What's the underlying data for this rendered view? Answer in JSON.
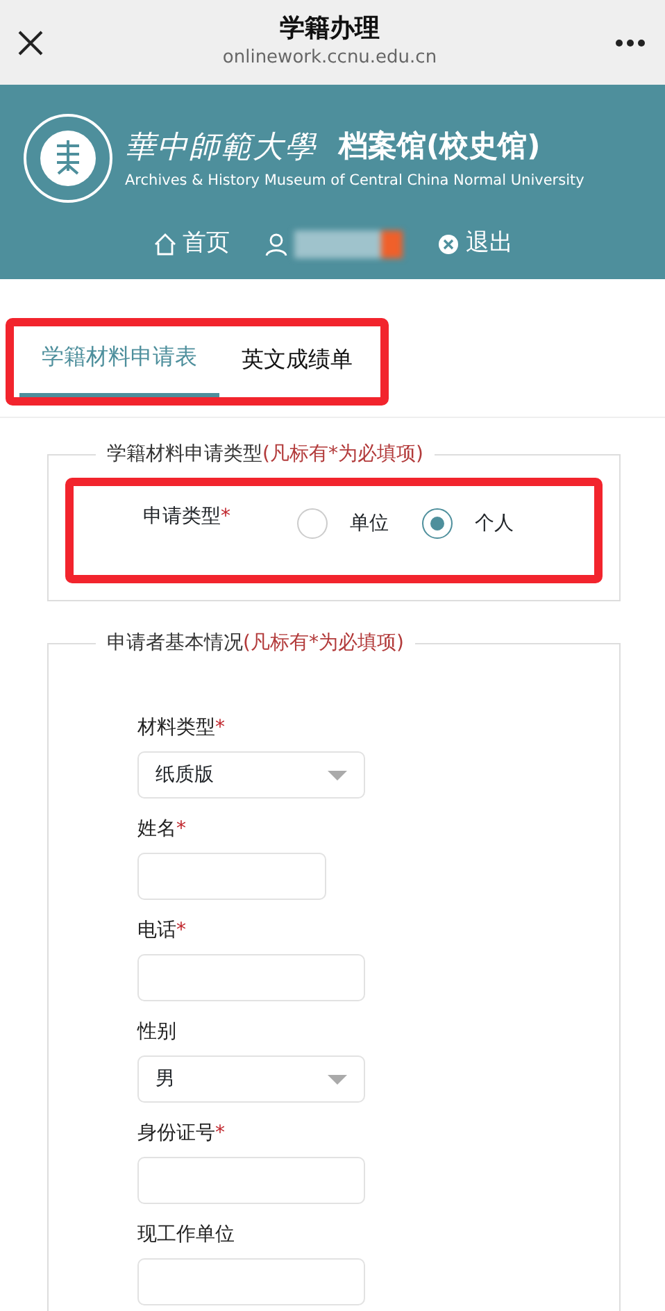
{
  "browser_bar": {
    "title": "学籍办理",
    "url": "onlinework.ccnu.edu.cn"
  },
  "header": {
    "university_name": "華中師範大學",
    "museum_name": "档案馆(校史馆)",
    "subtitle": "Archives & History Museum of Central China Normal University",
    "nav": [
      {
        "kind": "home",
        "label": "首页"
      },
      {
        "kind": "user"
      },
      {
        "kind": "logout",
        "label": "退出"
      }
    ]
  },
  "tabs": {
    "highlighted": true,
    "items": [
      {
        "label": "学籍材料申请表",
        "selected": true
      },
      {
        "label": "英文成绩单",
        "selected": false
      }
    ]
  },
  "sections": [
    {
      "legend": "学籍材料申请类型",
      "legend_note": "(凡标有*为必填项)",
      "kind": "radio",
      "highlighted": true,
      "label": "申请类型",
      "required_marker": "*",
      "options": [
        {
          "label": "单位",
          "selected": false
        },
        {
          "label": "个人",
          "selected": true
        }
      ]
    },
    {
      "legend": "申请者基本情况",
      "legend_note": "(凡标有*为必填项)",
      "kind": "fields",
      "fields": [
        {
          "kind": "select",
          "label": "材料类型",
          "required_marker": "*",
          "value": "纸质版"
        },
        {
          "kind": "short-text",
          "label": "姓名",
          "required_marker": "*"
        },
        {
          "kind": "text",
          "label": "电话",
          "required_marker": "*"
        },
        {
          "kind": "select",
          "label": "性别",
          "value": "男"
        },
        {
          "kind": "text",
          "label": "身份证号",
          "required_marker": "*"
        },
        {
          "kind": "text",
          "label": "现工作单位"
        }
      ]
    }
  ]
}
